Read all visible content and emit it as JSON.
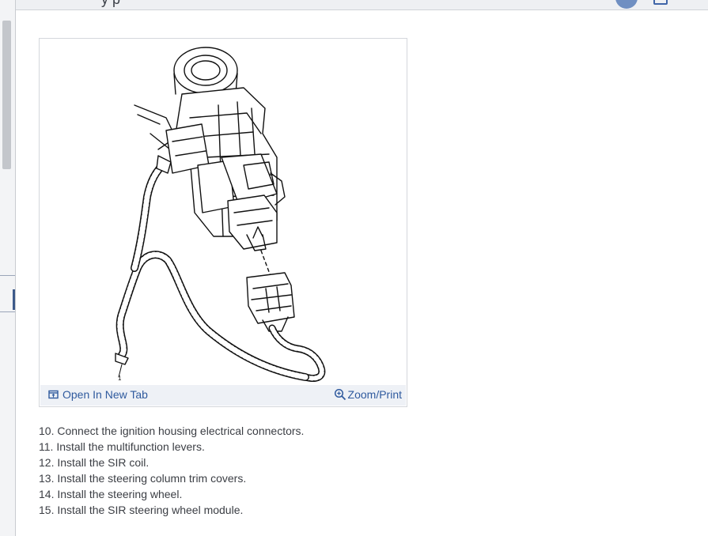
{
  "header": {
    "title_fragment": "y    p"
  },
  "figure": {
    "open_tab_label": "Open In New Tab",
    "zoom_label": "Zoom/Print",
    "callout_label": "1"
  },
  "steps": [
    {
      "num": "10.",
      "text": "Connect the ignition housing electrical connectors."
    },
    {
      "num": "11.",
      "text": "Install the multifunction levers."
    },
    {
      "num": "12.",
      "text": "Install the SIR coil."
    },
    {
      "num": "13.",
      "text": "Install the steering column trim covers."
    },
    {
      "num": "14.",
      "text": "Install the steering wheel."
    },
    {
      "num": "15.",
      "text": "Install the SIR steering wheel module."
    }
  ],
  "colors": {
    "link": "#2f5a9e",
    "toolbar_bg": "#eef1f6",
    "text": "#3b3e44"
  },
  "icons": [
    "open-in-new-tab-icon",
    "zoom-in-icon",
    "avatar",
    "header-icon"
  ]
}
